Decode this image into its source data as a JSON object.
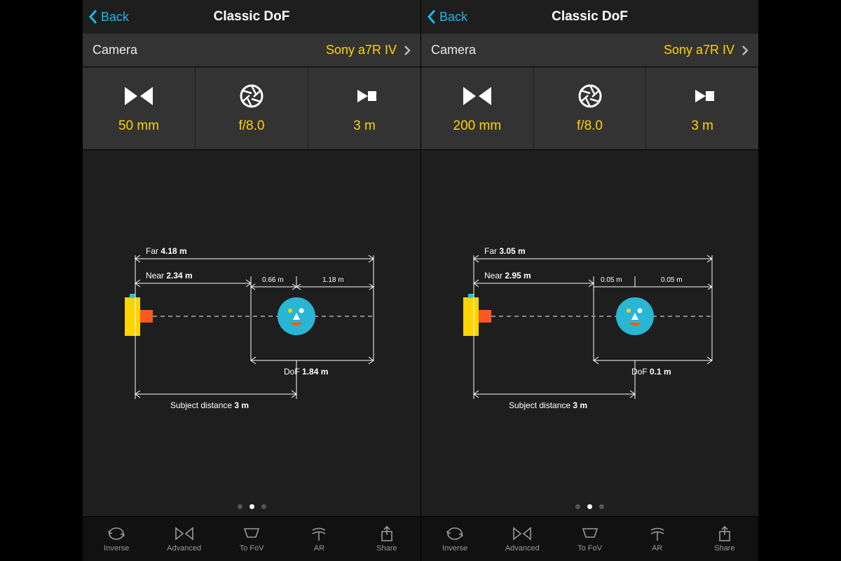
{
  "nav": {
    "back": "Back",
    "title": "Classic DoF"
  },
  "camera_row": {
    "label": "Camera",
    "value": "Sony a7R IV"
  },
  "tabs": {
    "inverse": "Inverse",
    "advanced": "Advanced",
    "tofov": "To FoV",
    "ar": "AR",
    "share": "Share"
  },
  "screens": [
    {
      "params": {
        "focal": "50 mm",
        "aperture": "f/8.0",
        "distance": "3 m"
      },
      "diagram": {
        "far_label": "Far",
        "far_value": "4.18 m",
        "near_label": "Near",
        "near_value": "2.34 m",
        "front_dof": "0.66 m",
        "rear_dof": "1.18 m",
        "dof_label": "DoF",
        "dof_value": "1.84 m",
        "subj_label": "Subject distance",
        "subj_value": "3 m"
      }
    },
    {
      "params": {
        "focal": "200 mm",
        "aperture": "f/8.0",
        "distance": "3 m"
      },
      "diagram": {
        "far_label": "Far",
        "far_value": "3.05 m",
        "near_label": "Near",
        "near_value": "2.95 m",
        "front_dof": "0.05 m",
        "rear_dof": "0.05 m",
        "dof_label": "DoF",
        "dof_value": "0.1 m",
        "subj_label": "Subject distance",
        "subj_value": "3 m"
      }
    }
  ]
}
